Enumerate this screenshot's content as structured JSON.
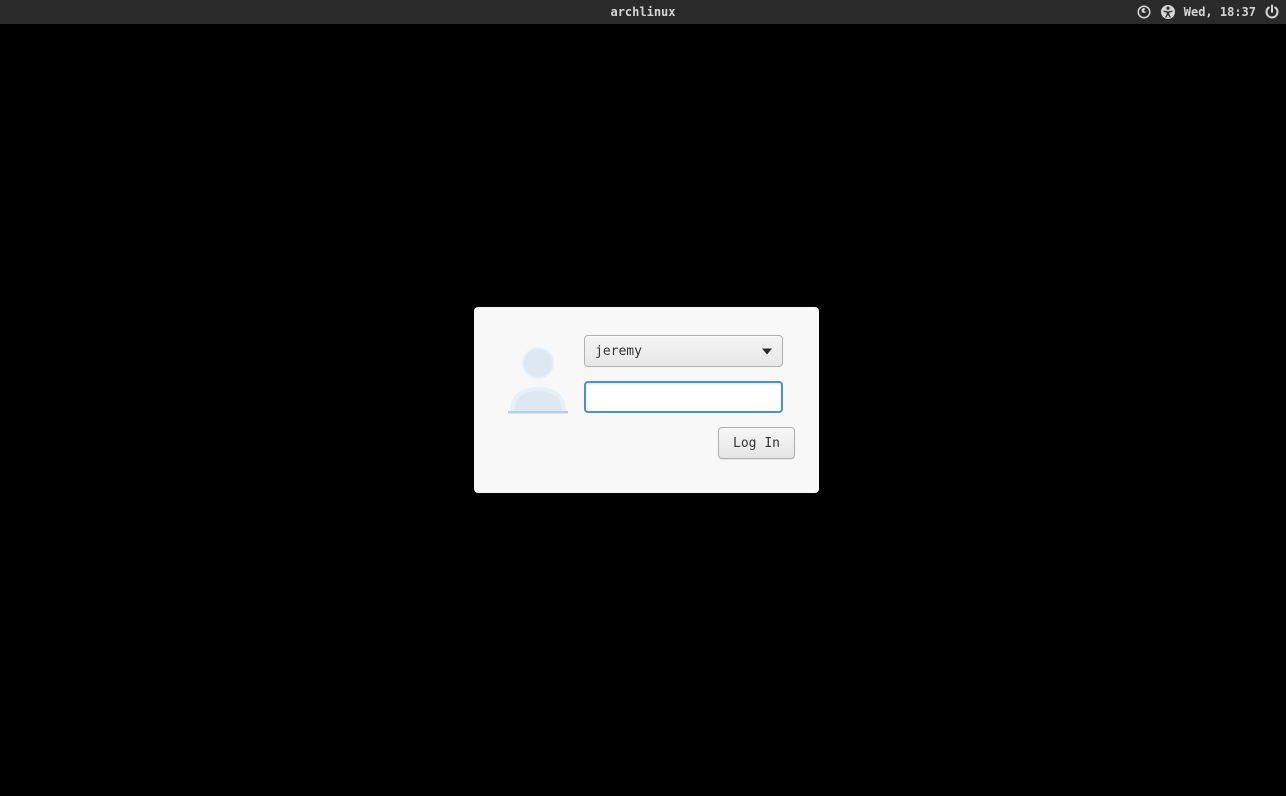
{
  "panel": {
    "hostname": "archlinux",
    "datetime": "Wed, 18:37"
  },
  "login": {
    "selected_user": "jeremy",
    "password_value": "",
    "login_button_label": "Log In"
  }
}
